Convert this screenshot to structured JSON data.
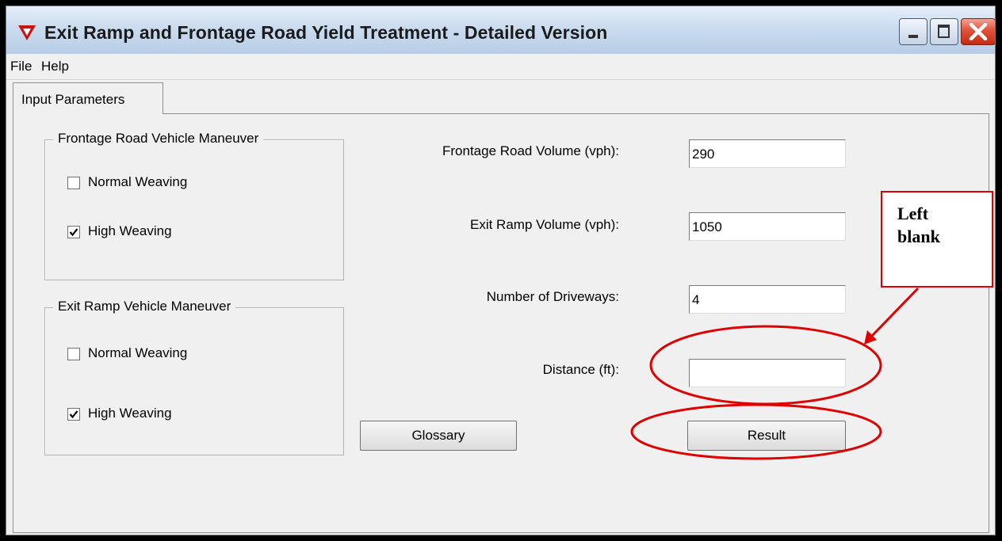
{
  "window": {
    "title": "Exit Ramp and Frontage Road Yield Treatment - Detailed Version"
  },
  "menu": [
    "File",
    "Help"
  ],
  "tab": {
    "label": "Input Parameters"
  },
  "frontage_group": {
    "title": "Frontage Road Vehicle Maneuver",
    "options": [
      {
        "label": "Normal Weaving",
        "checked": false
      },
      {
        "label": "High Weaving",
        "checked": true
      }
    ]
  },
  "exit_group": {
    "title": "Exit Ramp Vehicle Maneuver",
    "options": [
      {
        "label": "Normal Weaving",
        "checked": false
      },
      {
        "label": "High Weaving",
        "checked": true
      }
    ]
  },
  "fields": [
    {
      "label": "Frontage Road Volume (vph):",
      "value": "290"
    },
    {
      "label": "Exit Ramp Volume (vph):",
      "value": "1050"
    },
    {
      "label": "Number of Driveways:",
      "value": "4"
    },
    {
      "label": "Distance (ft):",
      "value": ""
    }
  ],
  "buttons": {
    "glossary": "Glossary",
    "result": "Result"
  },
  "annotation": {
    "text": "Left\nblank",
    "color": "#e00000"
  },
  "colors": {
    "title_icon": "#cc1111",
    "close_button": "#d9442c"
  }
}
